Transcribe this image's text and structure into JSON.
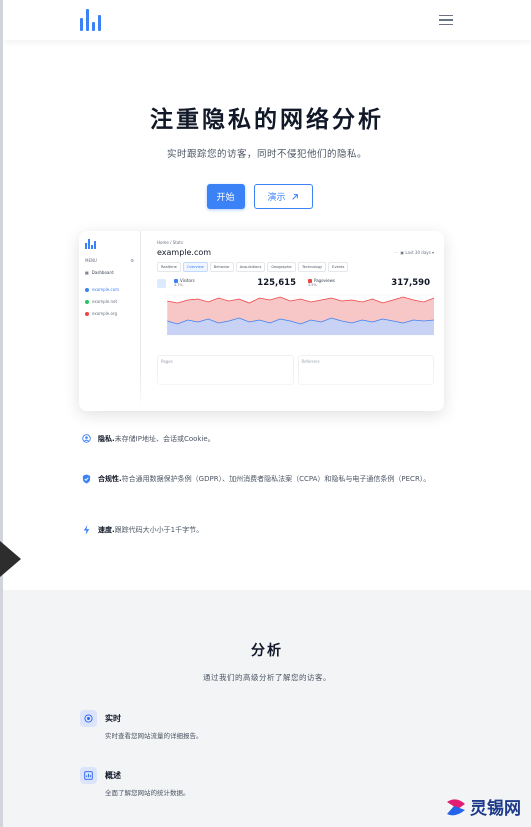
{
  "header": {
    "logo_icon": "bar-chart-logo-icon",
    "menu_icon": "hamburger-menu-icon"
  },
  "hero": {
    "title": "注重隐私的网络分析",
    "subtitle": "实时跟踪您的访客，同时不侵犯他们的隐私。",
    "primary_button": "开始",
    "demo_button": "演示",
    "demo_icon": "arrow-up-right-icon"
  },
  "dashboard": {
    "sidebar": {
      "menu_label": "MENU",
      "dashboard_label": "Dashboard",
      "sites": [
        {
          "label": "example.com",
          "color": "#3b82f6"
        },
        {
          "label": "example.net",
          "color": "#22c55e"
        },
        {
          "label": "example.org",
          "color": "#ef4444"
        }
      ]
    },
    "breadcrumb": "Home  /  Stats",
    "site_title": "example.com",
    "date_range": "Last 30 days",
    "tabs": [
      "Realtime",
      "Overview",
      "Behavior",
      "Acquisitions",
      "Geographic",
      "Technology",
      "Events"
    ],
    "stats": [
      {
        "label": "Visitors",
        "change": "4.7%",
        "value": "125,615",
        "color": "#3b82f6"
      },
      {
        "label": "Pageviews",
        "change": "3.5%",
        "value": "317,590",
        "color": "#ef4444"
      }
    ],
    "cards": [
      "Pages",
      "Referrers"
    ]
  },
  "features": [
    {
      "icon": "user-circle-icon",
      "title": "隐私.",
      "text": "未存储IP地址、会话或Cookie。"
    },
    {
      "icon": "shield-check-icon",
      "title": "合规性.",
      "text": "符合通用数据保护条例（GDPR）、加州消费者隐私法案（CCPA）和隐私与电子通信条例（PECR）。"
    },
    {
      "icon": "lightning-bolt-icon",
      "title": "速度.",
      "text": "跟踪代码大小小于1千字节。"
    }
  ],
  "analytics": {
    "title": "分析",
    "subtitle": "通过我们的高级分析了解您的访客。",
    "items": [
      {
        "icon": "realtime-target-icon",
        "title": "实时",
        "text": "实时查看您网站流量的详细报告。"
      },
      {
        "icon": "overview-chart-icon",
        "title": "概述",
        "text": "全面了解您网站的统计数据。"
      }
    ]
  },
  "watermark": {
    "text": "灵锡网"
  },
  "colors": {
    "accent": "#3b82f6",
    "pageviews": "#ef4444"
  }
}
